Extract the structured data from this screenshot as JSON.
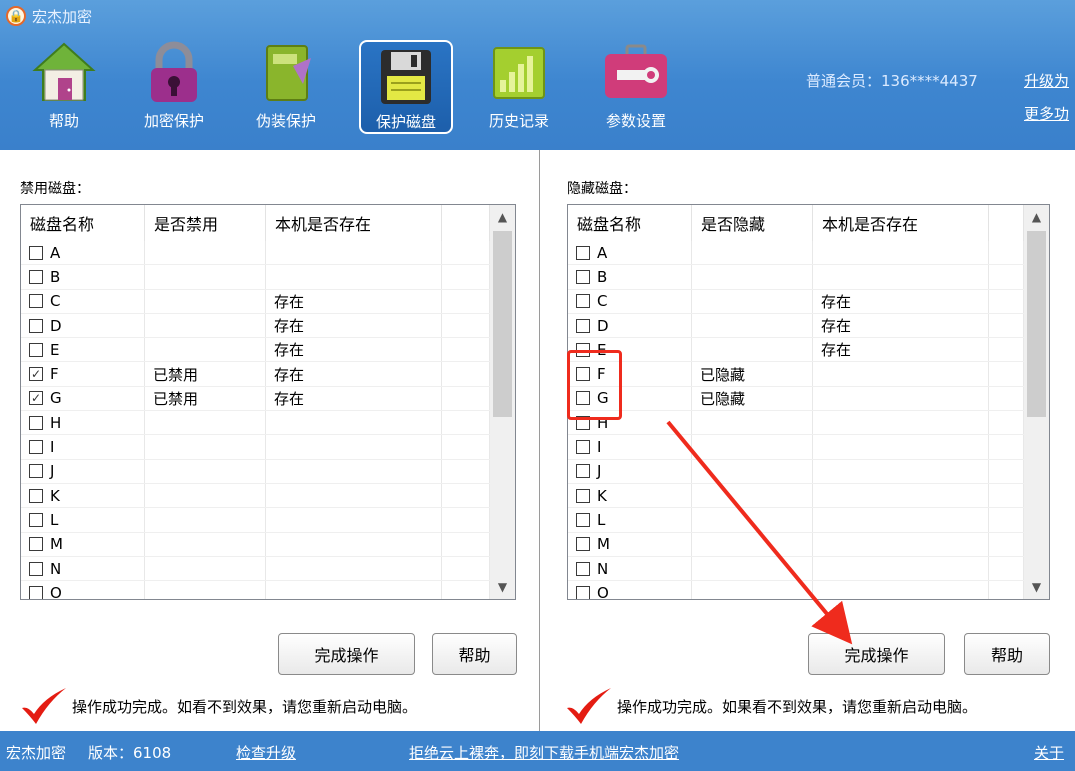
{
  "app": {
    "title": "宏杰加密",
    "logo_icon": "lock-badge-icon"
  },
  "toolbar": [
    {
      "label": "帮助",
      "icon": "house-icon",
      "active": false
    },
    {
      "label": "加密保护",
      "icon": "padlock-icon",
      "active": false
    },
    {
      "label": "伪装保护",
      "icon": "notebook-icon",
      "active": false
    },
    {
      "label": "保护磁盘",
      "icon": "floppy-disk-icon",
      "active": true
    },
    {
      "label": "历史记录",
      "icon": "bar-chart-icon",
      "active": false
    },
    {
      "label": "参数设置",
      "icon": "toolbox-icon",
      "active": false
    }
  ],
  "member": {
    "label": "普通会员：136****4437",
    "upgrade": "升级为",
    "more": "更多功"
  },
  "left_panel": {
    "title": "禁用磁盘：",
    "columns": [
      "磁盘名称",
      "是否禁用",
      "本机是否存在"
    ],
    "rows": [
      {
        "name": "A",
        "checked": false,
        "status": "",
        "exists": ""
      },
      {
        "name": "B",
        "checked": false,
        "status": "",
        "exists": ""
      },
      {
        "name": "C",
        "checked": false,
        "status": "",
        "exists": "存在"
      },
      {
        "name": "D",
        "checked": false,
        "status": "",
        "exists": "存在"
      },
      {
        "name": "E",
        "checked": false,
        "status": "",
        "exists": "存在"
      },
      {
        "name": "F",
        "checked": true,
        "status": "已禁用",
        "exists": "存在"
      },
      {
        "name": "G",
        "checked": true,
        "status": "已禁用",
        "exists": "存在"
      },
      {
        "name": "H",
        "checked": false,
        "status": "",
        "exists": ""
      },
      {
        "name": "I",
        "checked": false,
        "status": "",
        "exists": ""
      },
      {
        "name": "J",
        "checked": false,
        "status": "",
        "exists": ""
      },
      {
        "name": "K",
        "checked": false,
        "status": "",
        "exists": ""
      },
      {
        "name": "L",
        "checked": false,
        "status": "",
        "exists": ""
      },
      {
        "name": "M",
        "checked": false,
        "status": "",
        "exists": ""
      },
      {
        "name": "N",
        "checked": false,
        "status": "",
        "exists": ""
      },
      {
        "name": "O",
        "checked": false,
        "status": "",
        "exists": ""
      }
    ],
    "done_button": "完成操作",
    "help_button": "帮助",
    "status_text": "操作成功完成。如看不到效果，请您重新启动电脑。"
  },
  "right_panel": {
    "title": "隐藏磁盘：",
    "columns": [
      "磁盘名称",
      "是否隐藏",
      "本机是否存在"
    ],
    "rows": [
      {
        "name": "A",
        "checked": false,
        "status": "",
        "exists": ""
      },
      {
        "name": "B",
        "checked": false,
        "status": "",
        "exists": ""
      },
      {
        "name": "C",
        "checked": false,
        "status": "",
        "exists": "存在"
      },
      {
        "name": "D",
        "checked": false,
        "status": "",
        "exists": "存在"
      },
      {
        "name": "E",
        "checked": false,
        "status": "",
        "exists": "存在"
      },
      {
        "name": "F",
        "checked": false,
        "status": "已隐藏",
        "exists": ""
      },
      {
        "name": "G",
        "checked": false,
        "status": "已隐藏",
        "exists": ""
      },
      {
        "name": "H",
        "checked": false,
        "status": "",
        "exists": ""
      },
      {
        "name": "I",
        "checked": false,
        "status": "",
        "exists": ""
      },
      {
        "name": "J",
        "checked": false,
        "status": "",
        "exists": ""
      },
      {
        "name": "K",
        "checked": false,
        "status": "",
        "exists": ""
      },
      {
        "name": "L",
        "checked": false,
        "status": "",
        "exists": ""
      },
      {
        "name": "M",
        "checked": false,
        "status": "",
        "exists": ""
      },
      {
        "name": "N",
        "checked": false,
        "status": "",
        "exists": ""
      },
      {
        "name": "O",
        "checked": false,
        "status": "",
        "exists": ""
      }
    ],
    "done_button": "完成操作",
    "help_button": "帮助",
    "status_text": "操作成功完成。如果看不到效果，请您重新启动电脑。"
  },
  "footer": {
    "app_name": "宏杰加密",
    "version": "版本：6108",
    "check_update": "检查升级",
    "promo": "拒绝云上裸奔，即刻下载手机端宏杰加密",
    "about": "关于"
  },
  "colors": {
    "header_blue": "#3e86d0",
    "footer_blue": "#3d83cc",
    "annotation_red": "#ef2b1d",
    "check_red": "#e41c12"
  }
}
